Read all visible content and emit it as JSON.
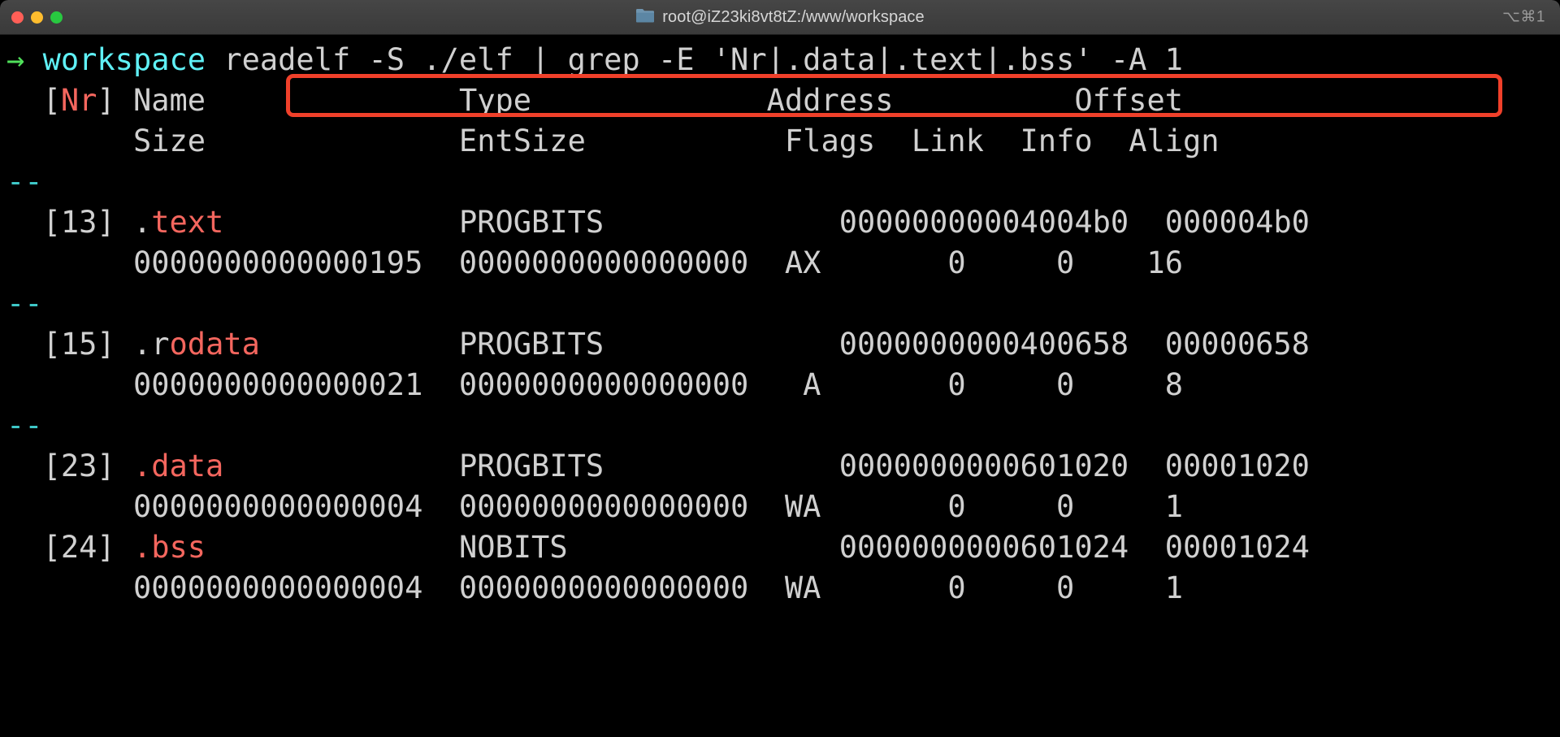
{
  "window": {
    "traffic_lights": [
      {
        "name": "close",
        "color": "#ff5f57"
      },
      {
        "name": "minimize",
        "color": "#ffbd2e"
      },
      {
        "name": "maximize",
        "color": "#28c840"
      }
    ],
    "folder_icon": "folder-icon",
    "title": "root@iZ23ki8vt8tZ:/www/workspace",
    "shortcut_hint": "⌥⌘1"
  },
  "prompt": {
    "arrow": "→",
    "cwd": "workspace",
    "command": "readelf -S ./elf | grep -E 'Nr|.data|.text|.bss' -A 1",
    "highlight_color": "#f0402a"
  },
  "colors": {
    "background": "#000000",
    "foreground": "#d0d0d0",
    "match_red": "#f4665e",
    "separator_cyan": "#3ec7c7",
    "cwd_cyan": "#5ff0f5",
    "arrow_green": "#4fe05a"
  },
  "output": {
    "header": {
      "line1": {
        "bracket_open": "[",
        "nr": "Nr",
        "bracket_close": "]",
        "name": "Name",
        "type": "Type",
        "address": "Address",
        "offset": "Offset"
      },
      "line2": {
        "size": "Size",
        "entsize": "EntSize",
        "flags": "Flags",
        "link": "Link",
        "info": "Info",
        "align": "Align"
      }
    },
    "separator": "--",
    "sections": [
      {
        "separator_before": true,
        "index": "[13]",
        "name_prefix": ".",
        "name_match": "text",
        "name_suffix": "",
        "type": "PROGBITS",
        "address": "00000000004004b0",
        "offset": "000004b0",
        "size": "0000000000000195",
        "entsize": "0000000000000000",
        "flags": "AX",
        "link": "0",
        "info": "0",
        "align": "16"
      },
      {
        "separator_before": true,
        "index": "[15]",
        "name_prefix": ".r",
        "name_match": "odata",
        "name_suffix": "",
        "type": "PROGBITS",
        "address": "0000000000400658",
        "offset": "00000658",
        "size": "0000000000000021",
        "entsize": "0000000000000000",
        "flags": "A",
        "link": "0",
        "info": "0",
        "align": "8"
      },
      {
        "separator_before": true,
        "index": "[23]",
        "name_prefix": "",
        "name_match": ".data",
        "name_suffix": "",
        "type": "PROGBITS",
        "address": "0000000000601020",
        "offset": "00001020",
        "size": "0000000000000004",
        "entsize": "0000000000000000",
        "flags": "WA",
        "link": "0",
        "info": "0",
        "align": "1"
      },
      {
        "separator_before": false,
        "index": "[24]",
        "name_prefix": "",
        "name_match": ".bss",
        "name_suffix": "",
        "type": "NOBITS",
        "address": "0000000000601024",
        "offset": "00001024",
        "size": "0000000000000004",
        "entsize": "0000000000000000",
        "flags": "WA",
        "link": "0",
        "info": "0",
        "align": "1"
      }
    ]
  }
}
